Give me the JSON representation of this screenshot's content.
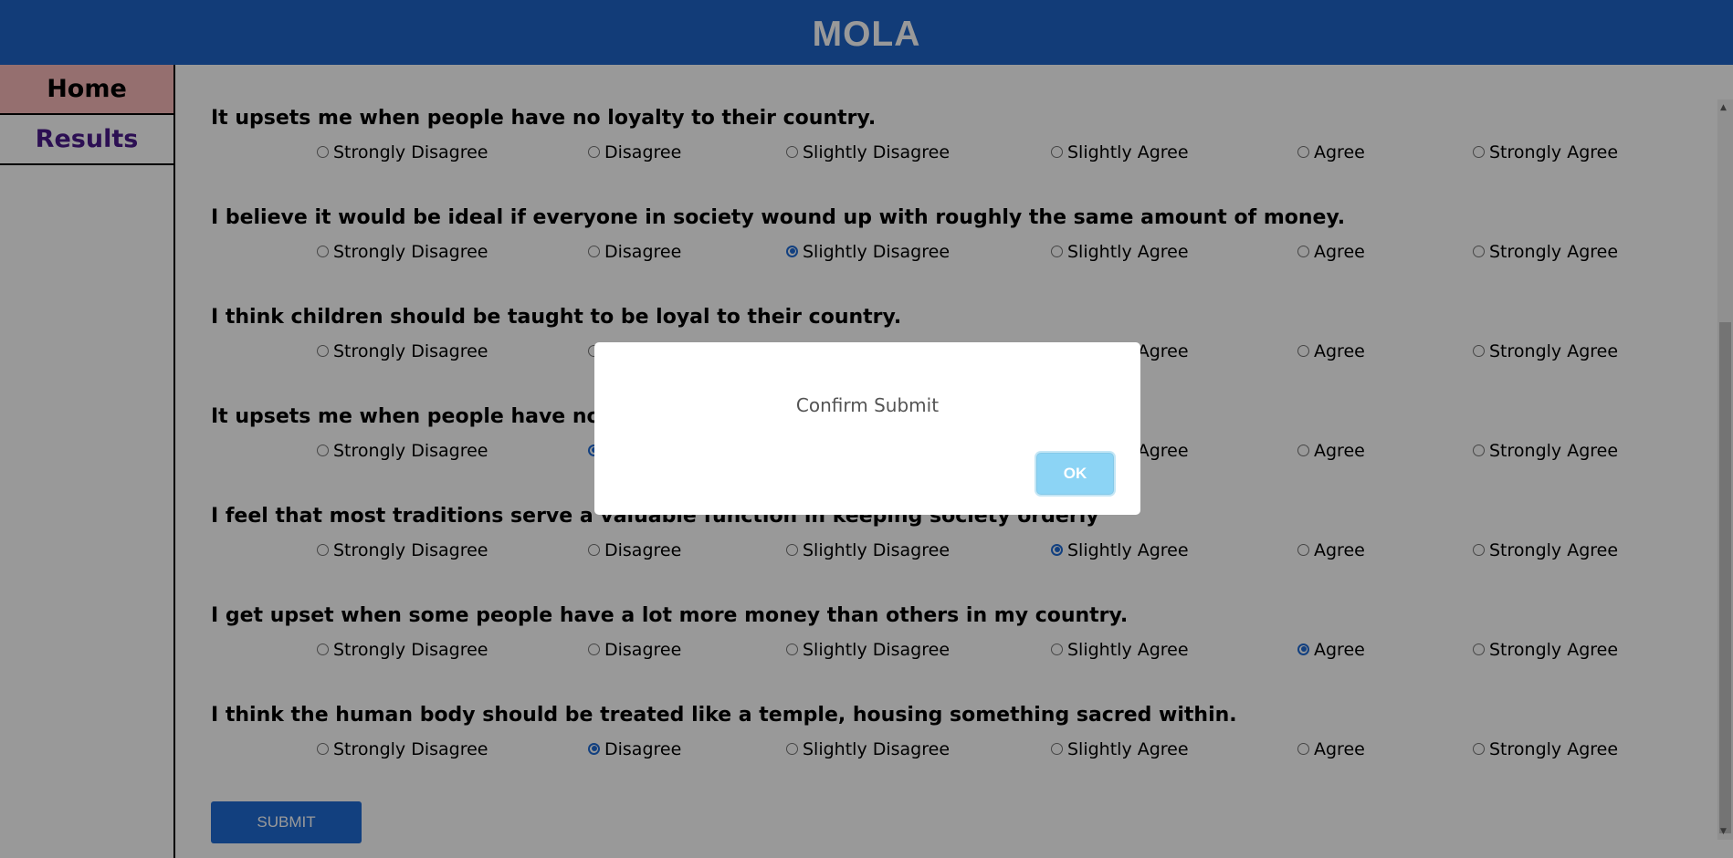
{
  "header": {
    "title": "MOLA"
  },
  "sidebar": {
    "items": [
      {
        "label": "Home"
      },
      {
        "label": "Results"
      }
    ]
  },
  "options": [
    "Strongly Disagree",
    "Disagree",
    "Slightly Disagree",
    "Slightly Agree",
    "Agree",
    "Strongly Agree"
  ],
  "questions": [
    {
      "text": "It upsets me when people have no loyalty to their country.",
      "selected": null
    },
    {
      "text": "I believe it would be ideal if everyone in society wound up with roughly the same amount of money.",
      "selected": "Slightly Disagree"
    },
    {
      "text": "I think children should be taught to be loyal to their country.",
      "selected": null
    },
    {
      "text": "It upsets me when people have no loyalty to their country.",
      "selected": "Disagree"
    },
    {
      "text": "I feel that most traditions serve a valuable function in keeping society orderly",
      "selected": "Slightly Agree"
    },
    {
      "text": "I get upset when some people have a lot more money than others in my country.",
      "selected": "Agree"
    },
    {
      "text": "I think the human body should be treated like a temple, housing something sacred within.",
      "selected": "Disagree"
    }
  ],
  "form": {
    "submit_label": "SUBMIT"
  },
  "dialog": {
    "message": "Confirm Submit",
    "ok_label": "OK"
  }
}
